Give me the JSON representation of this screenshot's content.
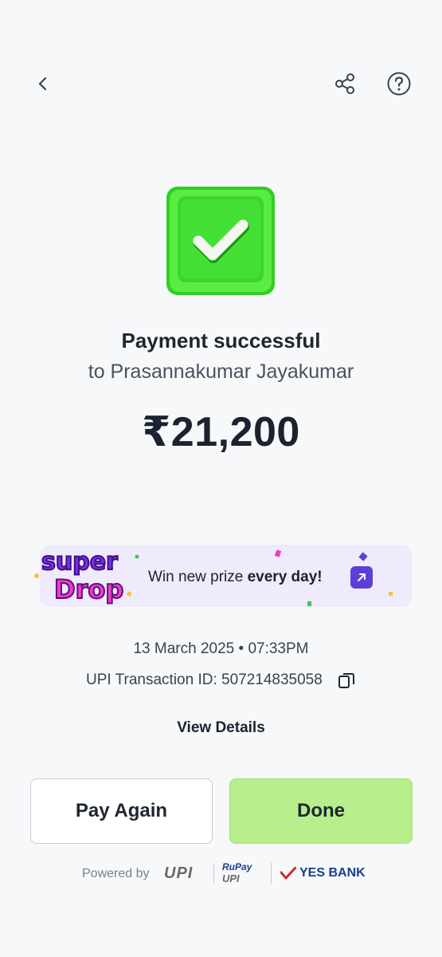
{
  "header": {
    "back_icon": "chevron-left-icon",
    "share_icon": "share-icon",
    "help_icon": "help-circle-icon"
  },
  "status": {
    "title": "Payment successful",
    "subtitle": "to Prasannakumar Jayakumar",
    "amount": "₹21,200",
    "icon": "checkmark-icon",
    "icon_color": "#39d62b"
  },
  "promo": {
    "logo_line1": "super",
    "logo_line2": "Drop",
    "text_prefix": "Win new prize ",
    "text_bold": "every day!",
    "arrow_icon": "arrow-up-right-icon"
  },
  "details": {
    "datetime": "13 March 2025 • 07:33PM",
    "txn_label": "UPI Transaction ID: 507214835058",
    "copy_icon": "copy-icon",
    "view_details": "View Details"
  },
  "actions": {
    "pay_again": "Pay Again",
    "done": "Done",
    "done_color": "#b6ef8b"
  },
  "footer": {
    "powered_by": "Powered by",
    "upi": "UPI",
    "rupay_top": "RuPay",
    "rupay_bottom": "UPI",
    "bank": "YES BANK"
  }
}
